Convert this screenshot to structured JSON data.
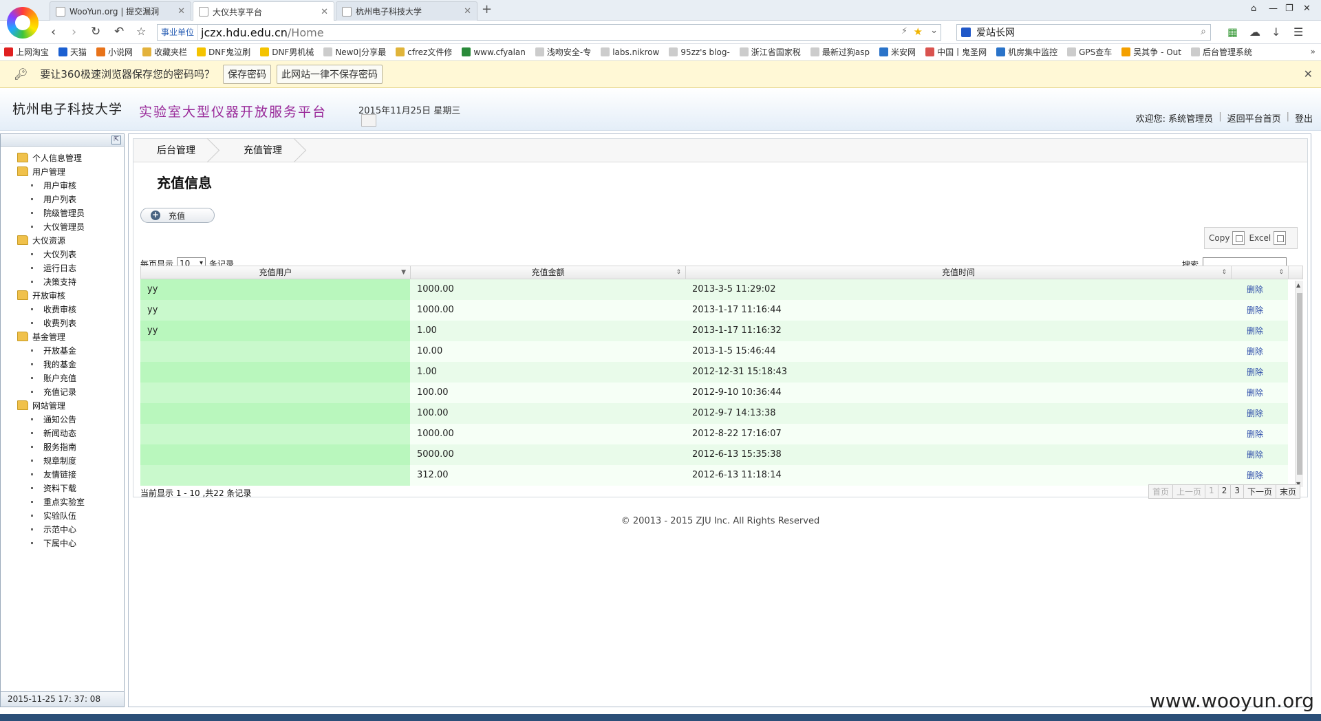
{
  "browser": {
    "tabs": [
      {
        "title": "WooYun.org | 提交漏洞",
        "active": false
      },
      {
        "title": "大仪共享平台",
        "active": true
      },
      {
        "title": "杭州电子科技大学",
        "active": false
      }
    ],
    "address": {
      "badge": "事业单位",
      "host": "jczx.hdu.edu.cn",
      "path": "/Home"
    },
    "search_value": "爱站长网",
    "bookmarks": [
      {
        "label": "上网淘宝",
        "icon_color": "#e02020"
      },
      {
        "label": "天猫",
        "icon_color": "#1b5fd1"
      },
      {
        "label": "小说网",
        "icon_color": "#e8731a"
      },
      {
        "label": "收藏夹栏",
        "icon_color": "#e3b23c"
      },
      {
        "label": "DNF鬼泣刷",
        "icon_color": "#f4c300"
      },
      {
        "label": "DNF男机械",
        "icon_color": "#f4c300"
      },
      {
        "label": "New0|分享最",
        "icon_color": "#cccccc"
      },
      {
        "label": "cfrez文件修",
        "icon_color": "#e0b43a"
      },
      {
        "label": "www.cfyalan",
        "icon_color": "#2a8a3a"
      },
      {
        "label": "浅吻安全-专",
        "icon_color": "#cccccc"
      },
      {
        "label": "labs.nikrow",
        "icon_color": "#cccccc"
      },
      {
        "label": "95zz's blog-",
        "icon_color": "#cccccc"
      },
      {
        "label": "浙江省国家税",
        "icon_color": "#cccccc"
      },
      {
        "label": "最新过狗asp",
        "icon_color": "#cccccc"
      },
      {
        "label": "米安网",
        "icon_color": "#2a73c9"
      },
      {
        "label": "中国丨鬼圣网",
        "icon_color": "#d9534f"
      },
      {
        "label": "机房集中监控",
        "icon_color": "#2a73c9"
      },
      {
        "label": "GPS查车",
        "icon_color": "#cccccc"
      },
      {
        "label": "吴其争 - Out",
        "icon_color": "#f4a000"
      },
      {
        "label": "后台管理系统",
        "icon_color": "#cccccc"
      }
    ],
    "bookmark_more": "»",
    "password_bar": {
      "message": "要让360极速浏览器保存您的密码吗？",
      "save_label": "保存密码",
      "never_label": "此网站一律不保存密码",
      "close": "✕"
    }
  },
  "header": {
    "school": "杭州电子科技大学",
    "platform": "实验室大型仪器开放服务平台",
    "date": "2015年11月25日 星期三",
    "welcome": "欢迎您: 系统管理员",
    "return_link": "返回平台首页",
    "logout": "登出",
    "sep": "|"
  },
  "sidebar": {
    "groups": [
      {
        "title": "个人信息管理",
        "items": []
      },
      {
        "title": "用户管理",
        "items": [
          "用户审核",
          "用户列表",
          "院级管理员",
          "大仪管理员"
        ]
      },
      {
        "title": "大仪资源",
        "items": [
          "大仪列表",
          "运行日志",
          "决策支持"
        ]
      },
      {
        "title": "开放审核",
        "items": [
          "收费审核",
          "收费列表"
        ]
      },
      {
        "title": "基金管理",
        "items": [
          "开放基金",
          "我的基金",
          "账户充值",
          "充值记录"
        ]
      },
      {
        "title": "网站管理",
        "items": [
          "通知公告",
          "新闻动态",
          "服务指南",
          "规章制度",
          "友情链接",
          "资料下载",
          "重点实验室",
          "实验队伍",
          "示范中心",
          "下属中心"
        ]
      }
    ],
    "clock": "2015-11-25  17: 37: 08"
  },
  "main": {
    "breadcrumb": [
      "后台管理",
      "充值管理"
    ],
    "title": "充值信息",
    "add_label": "充值",
    "export": {
      "copy": "Copy",
      "excel": "Excel"
    },
    "length": {
      "prefix": "每页显示",
      "value": "10",
      "suffix": "条记录"
    },
    "search_label": "搜索",
    "columns": [
      "充值用户",
      "充值金额",
      "充值时间",
      ""
    ],
    "rows": [
      {
        "user": "yy",
        "amount": "1000.00",
        "time": "2013-3-5 11:29:02",
        "action": "删除"
      },
      {
        "user": "yy",
        "amount": "1000.00",
        "time": "2013-1-17 11:16:44",
        "action": "删除"
      },
      {
        "user": "yy",
        "amount": "1.00",
        "time": "2013-1-17 11:16:32",
        "action": "删除"
      },
      {
        "user": "",
        "amount": "10.00",
        "time": "2013-1-5 15:46:44",
        "action": "删除"
      },
      {
        "user": "",
        "amount": "1.00",
        "time": "2012-12-31 15:18:43",
        "action": "删除"
      },
      {
        "user": "",
        "amount": "100.00",
        "time": "2012-9-10 10:36:44",
        "action": "删除"
      },
      {
        "user": "",
        "amount": "100.00",
        "time": "2012-9-7 14:13:38",
        "action": "删除"
      },
      {
        "user": "",
        "amount": "1000.00",
        "time": "2012-8-22 17:16:07",
        "action": "删除"
      },
      {
        "user": "",
        "amount": "5000.00",
        "time": "2012-6-13 15:35:38",
        "action": "删除"
      },
      {
        "user": "",
        "amount": "312.00",
        "time": "2012-6-13 11:18:14",
        "action": "删除"
      }
    ],
    "info": "当前显示 1 - 10 ,共22 条记录",
    "pager": {
      "first": "首页",
      "prev": "上一页",
      "pages": [
        "1",
        "2",
        "3"
      ],
      "next": "下一页",
      "last": "末页"
    },
    "copyright": "© 20013 - 2015 ZJU Inc. All Rights Reserved"
  },
  "watermark": "www.wooyun.org"
}
